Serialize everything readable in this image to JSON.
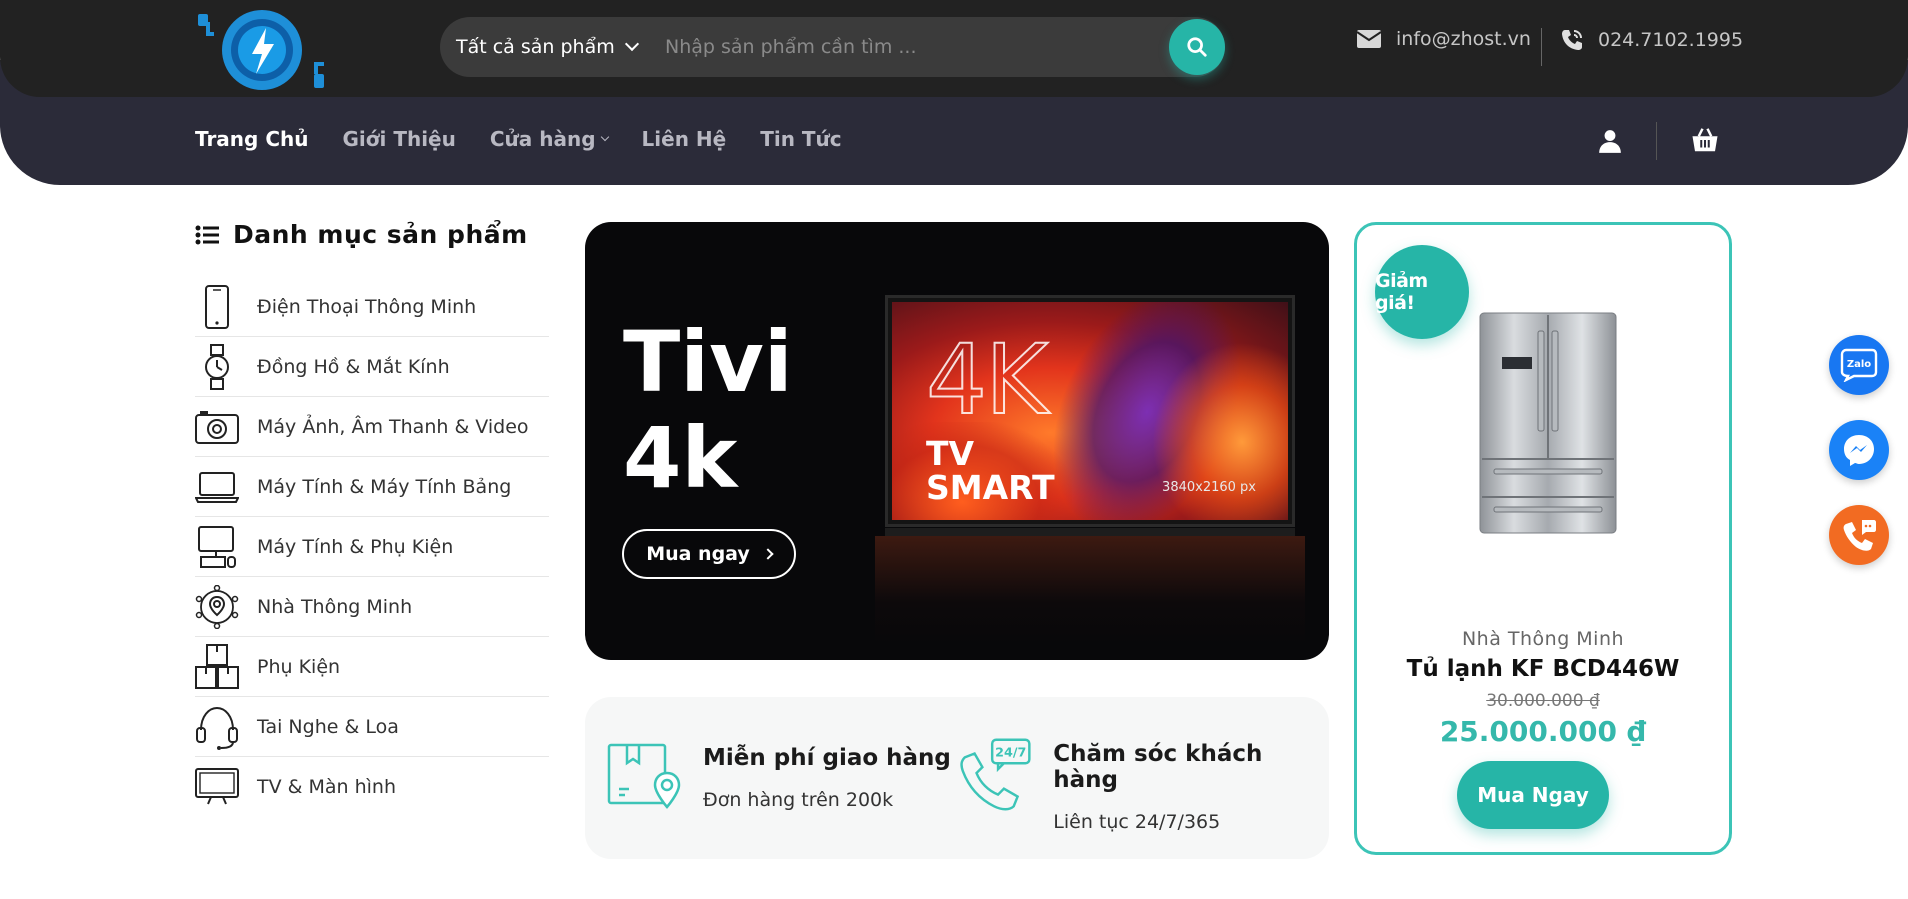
{
  "header": {
    "search": {
      "category": "Tất cả sản phẩm",
      "placeholder": "Nhập sản phẩm cần tìm ..."
    },
    "email": "info@zhost.vn",
    "phone": "024.7102.1995"
  },
  "nav": {
    "items": [
      {
        "label": "Trang Chủ"
      },
      {
        "label": "Giới Thiệu"
      },
      {
        "label": "Cửa hàng"
      },
      {
        "label": "Liên Hệ"
      },
      {
        "label": "Tin Tức"
      }
    ]
  },
  "sidebar": {
    "title": "Danh mục sản phẩm",
    "items": [
      {
        "label": "Điện Thoại Thông Minh",
        "icon": "smartphone-icon"
      },
      {
        "label": "Đồng Hồ & Mắt Kính",
        "icon": "watch-icon"
      },
      {
        "label": "Máy Ảnh, Âm Thanh & Video",
        "icon": "camera-icon"
      },
      {
        "label": "Máy Tính & Máy Tính Bảng",
        "icon": "laptop-icon"
      },
      {
        "label": "Máy Tính & Phụ Kiện",
        "icon": "desktop-icon"
      },
      {
        "label": "Nhà Thông Minh",
        "icon": "smart-home-icon"
      },
      {
        "label": "Phụ Kiện",
        "icon": "boxes-icon"
      },
      {
        "label": "Tai Nghe & Loa",
        "icon": "headset-icon"
      },
      {
        "label": "TV & Màn hình",
        "icon": "tv-icon"
      }
    ]
  },
  "banner": {
    "title_line1": "Tivi",
    "title_line2": "4k",
    "button": "Mua ngay",
    "tv_label_4k": "4K",
    "tv_smart_line1": "TV",
    "tv_smart_line2": "SMART",
    "tv_resolution": "3840x2160 px"
  },
  "info": {
    "shipping": {
      "title": "Miễn phí giao hàng",
      "subtitle": "Đơn hàng trên 200k"
    },
    "support": {
      "title": "Chăm sóc khách hàng",
      "subtitle": "Liên tục 24/7/365",
      "badge": "24/7"
    }
  },
  "product": {
    "badge": "Giảm giá!",
    "category": "Nhà Thông Minh",
    "name": "Tủ lạnh KF BCD446W",
    "old_price": "30.000.000 ₫",
    "new_price": "25.000.000 ₫",
    "button": "Mua Ngay"
  },
  "float": {
    "zalo": "Zalo"
  },
  "colors": {
    "accent": "#26b5a7",
    "header_top": "#222222",
    "header_nav": "#2b2b39"
  }
}
